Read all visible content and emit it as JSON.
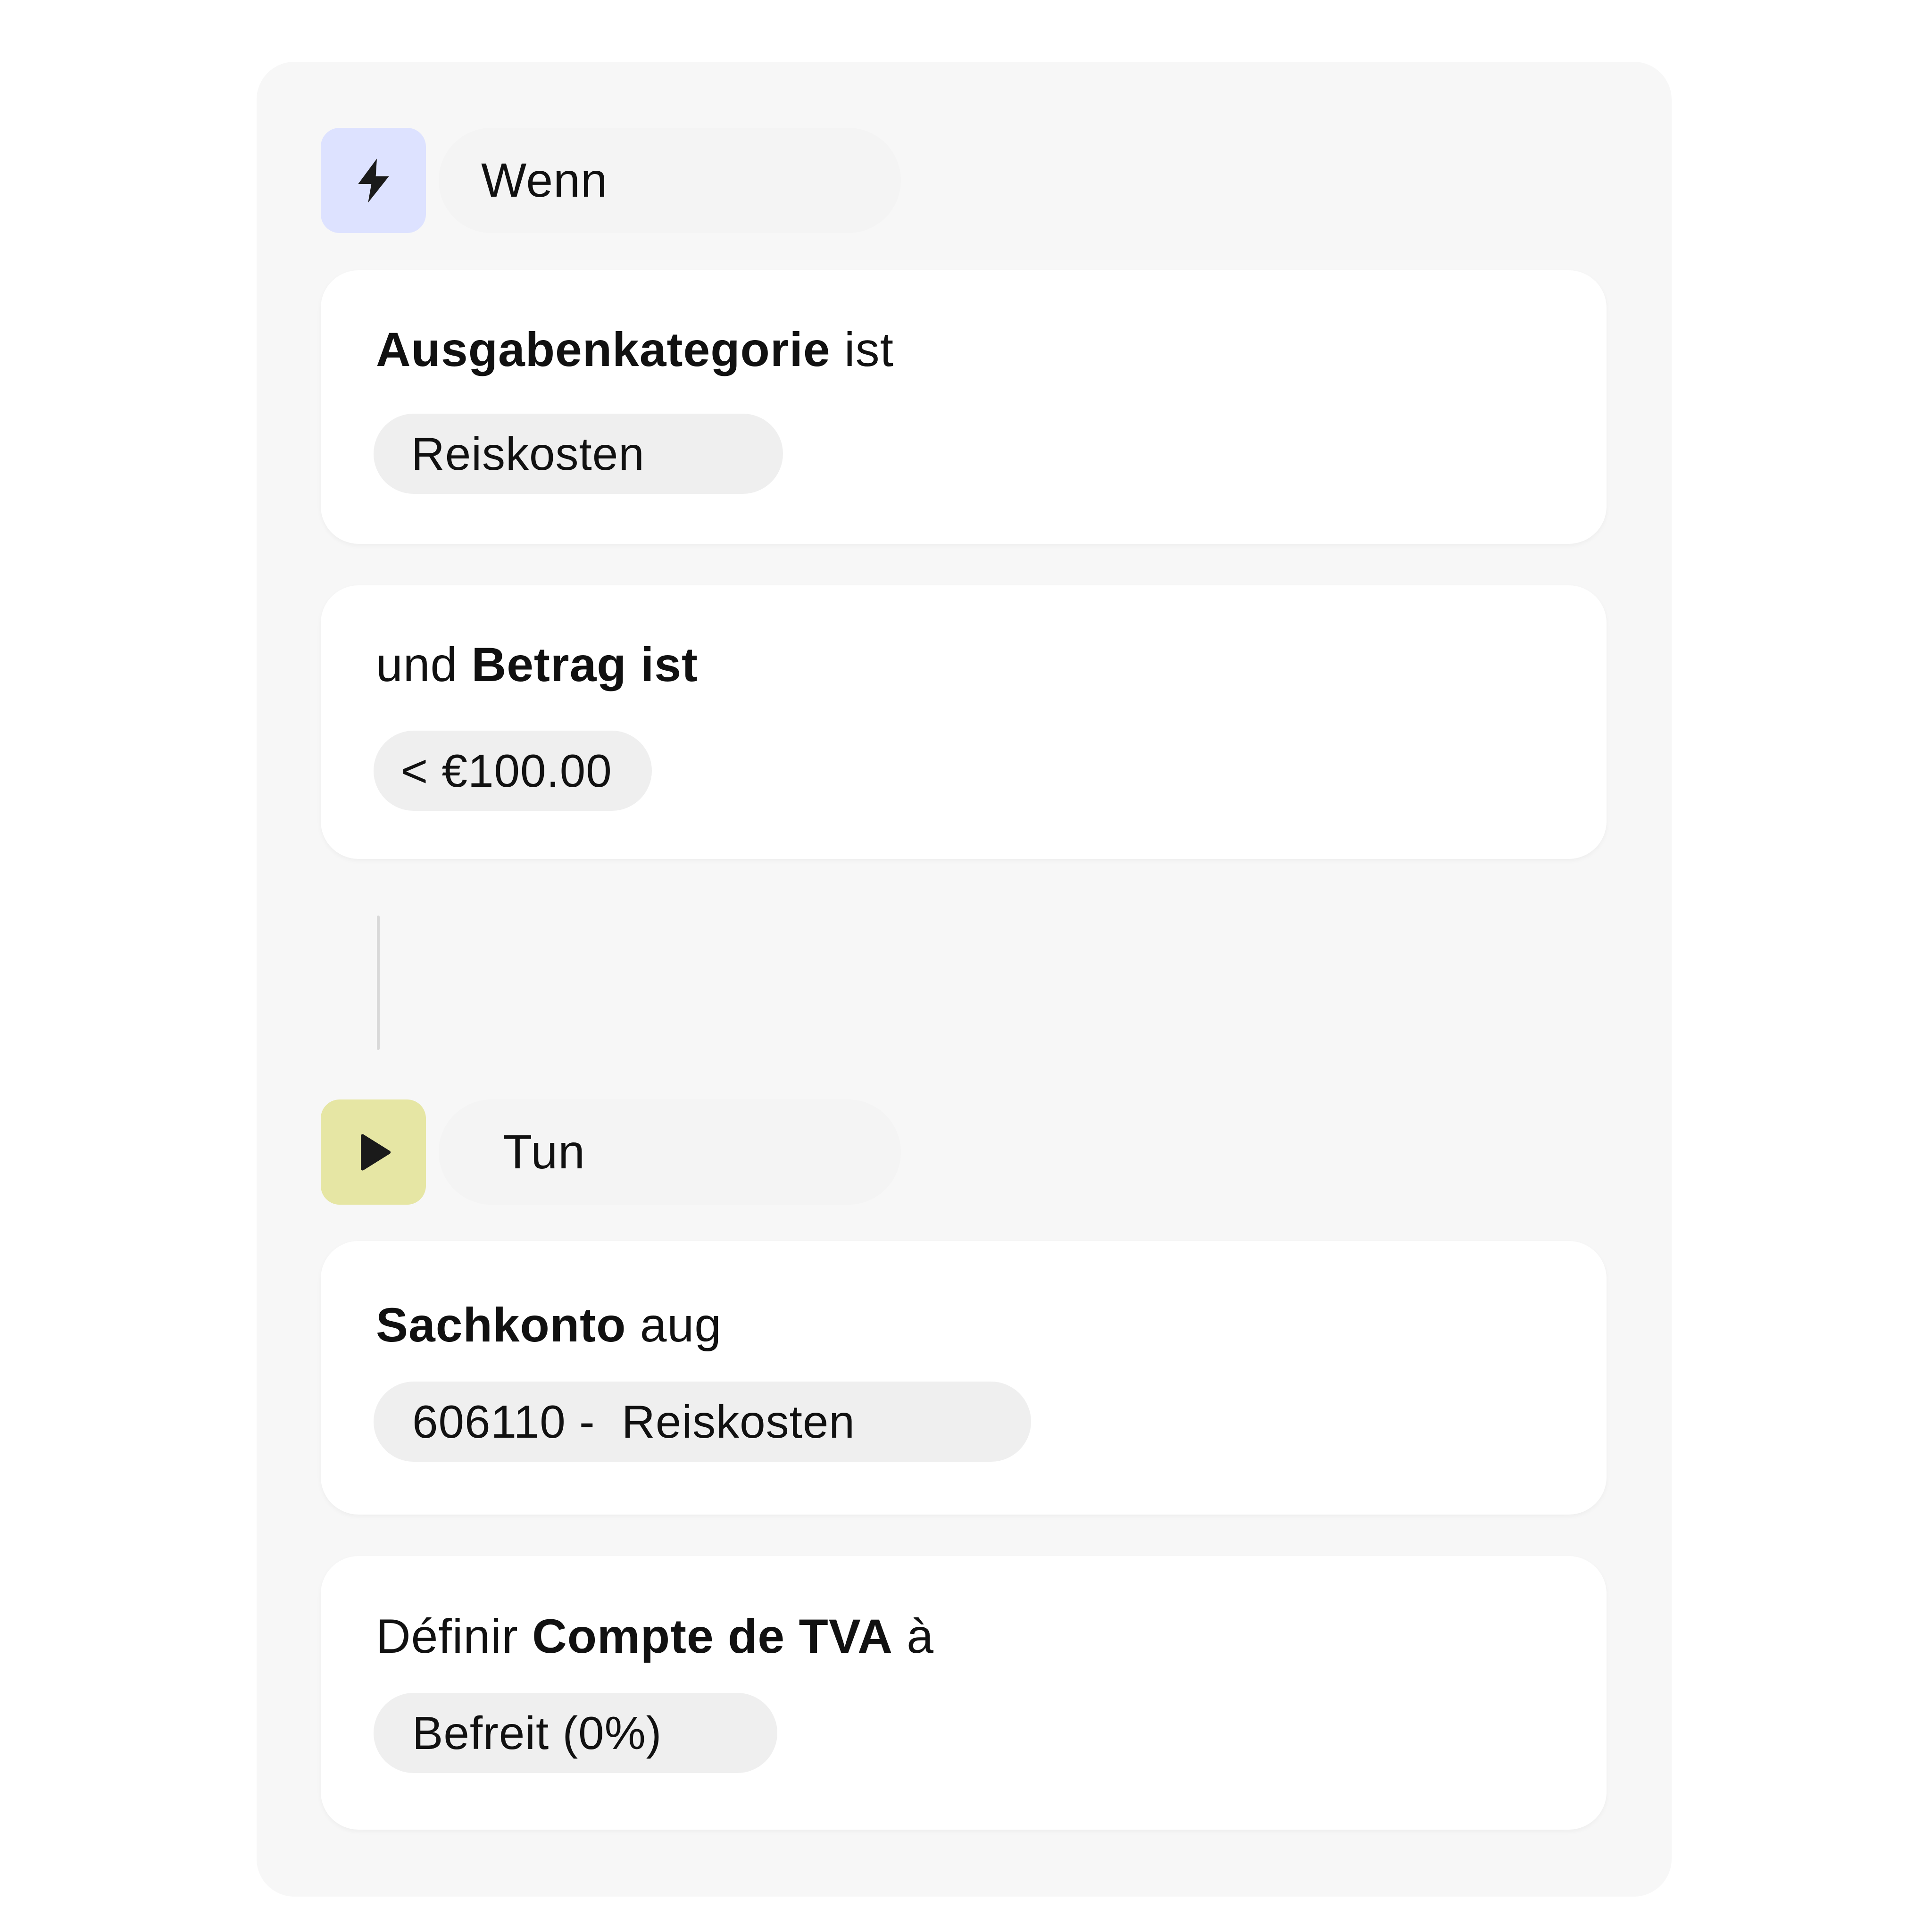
{
  "trigger": {
    "icon": "lightning-icon",
    "label": "Wenn",
    "accent": "#dde2ff"
  },
  "conditions": [
    {
      "title_bold": "Ausgabenkategorie",
      "title_after": " ist",
      "value": "Reiskosten"
    },
    {
      "title_before": "und ",
      "title_bold": "Betrag",
      "title_after": " ist",
      "value": "< €100.00"
    }
  ],
  "action": {
    "icon": "play-icon",
    "label": "Tun",
    "accent": "#e6e6a4"
  },
  "actions": [
    {
      "title_bold": "Sachkonto",
      "title_after": " aug",
      "value": "606110 -  Reiskosten"
    },
    {
      "title_before": "Définir ",
      "title_bold": "Compte de TVA",
      "title_after": " à",
      "value": "Befreit (0%)"
    }
  ]
}
